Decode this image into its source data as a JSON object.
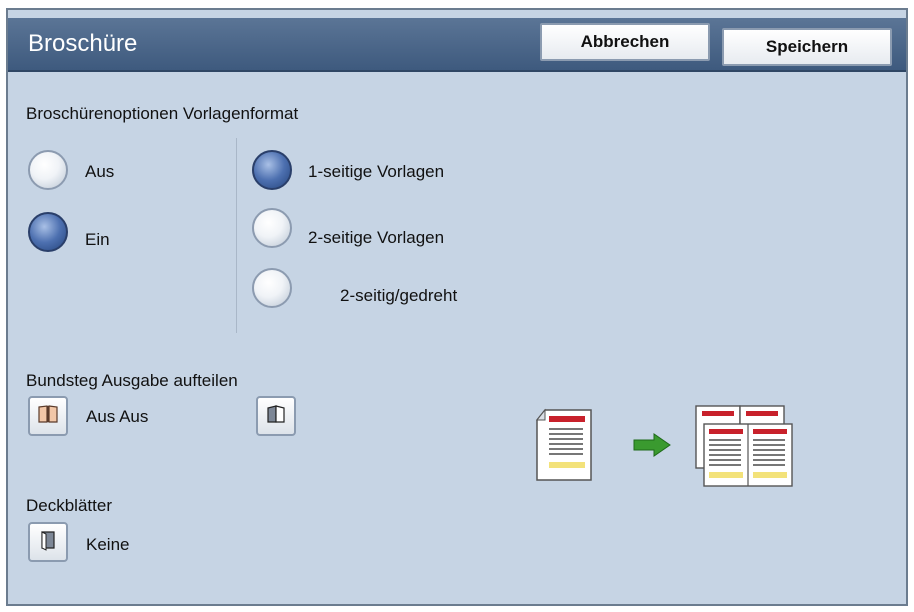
{
  "header": {
    "title": "Broschüre",
    "cancel_label": "Abbrechen",
    "save_label": "Speichern"
  },
  "section": {
    "heading": "Broschürenoptionen Vorlagenformat"
  },
  "booklet_options": [
    {
      "label": "Aus",
      "selected": false
    },
    {
      "label": "Ein",
      "selected": true
    }
  ],
  "original_format": [
    {
      "label": "1-seitige Vorlagen",
      "selected": true
    },
    {
      "label": "2-seitige Vorlagen",
      "selected": false
    },
    {
      "label": "2-seitig/gedreht",
      "selected": false
    }
  ],
  "split_output": {
    "heading": "Bundsteg Ausgabe aufteilen",
    "value": "Aus Aus"
  },
  "covers": {
    "heading": "Deckblätter",
    "value": "Keine"
  },
  "colors": {
    "accent": "#3e5a7e",
    "panel": "#c6d4e4",
    "doc_red": "#c8212b",
    "doc_yellow": "#f3e27a",
    "arrow_green": "#3a9a2f"
  }
}
